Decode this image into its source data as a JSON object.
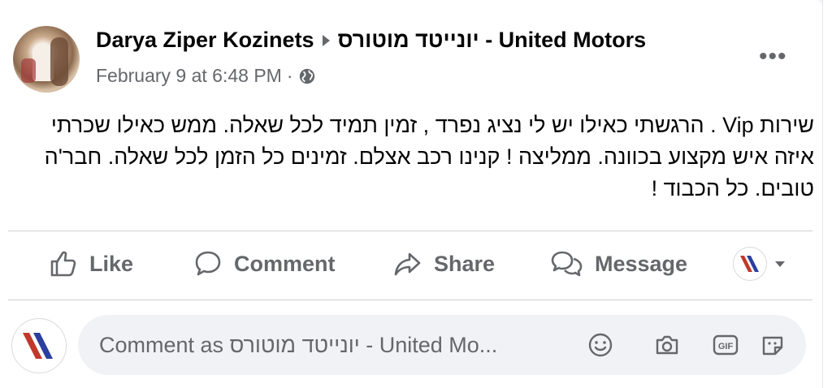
{
  "post": {
    "author_name": "Darya Ziper Kozinets",
    "group_name": "יונייטד מוטורס - United Motors",
    "timestamp": "February 9 at 6:48 PM",
    "separator": "·",
    "privacy_icon": "globe-icon",
    "more_label": "•••",
    "text": "שירות Vip . הרגשתי כאילו יש לי נציג נפרד , זמין תמיד לכל שאלה. ממש כאילו שכרתי איזה איש מקצוע בכוונה. ממליצה ! קנינו רכב אצלם. זמינים כל הזמן לכל שאלה. חבר'ה טובים. כל הכבוד !"
  },
  "actions": {
    "like": "Like",
    "comment": "Comment",
    "share": "Share",
    "message": "Message"
  },
  "comment_input": {
    "placeholder": "Comment as יונייטד מוטורס - United Mo..."
  },
  "icons": [
    "like-icon",
    "comment-icon",
    "share-icon",
    "message-icon",
    "emoji-icon",
    "camera-icon",
    "gif-icon",
    "sticker-icon",
    "chevron-down-icon"
  ],
  "colors": {
    "brand_red": "#c0392b",
    "brand_blue": "#2c3e9e",
    "text_secondary": "#65676b",
    "input_bg": "#f0f2f5"
  }
}
